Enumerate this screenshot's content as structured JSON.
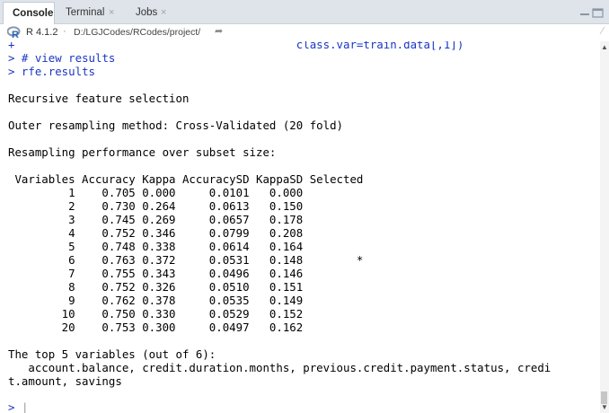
{
  "tabs": [
    {
      "label": "Console",
      "active": true
    },
    {
      "label": "Terminal",
      "close": "×"
    },
    {
      "label": "Jobs",
      "close": "×"
    }
  ],
  "path_bar": {
    "r_version": "R 4.1.2",
    "separator": "·",
    "working_dir": "D:/LGJCodes/RCodes/project/",
    "arrow_icon": "share-arrow-icon"
  },
  "console": {
    "top_cut_line": {
      "prompt": "+",
      "text": "                                          class.var=train.data[,1])"
    },
    "commands": [
      {
        "prompt": ">",
        "text": " # view results"
      },
      {
        "prompt": ">",
        "text": " rfe.results"
      }
    ],
    "title": "Recursive feature selection",
    "outer_method": "Outer resampling method: Cross-Validated (20 fold)",
    "perf_heading": "Resampling performance over subset size:",
    "table_header": " Variables Accuracy Kappa AccuracySD KappaSD Selected",
    "table_rows": [
      "         1    0.705 0.000     0.0101   0.000         ",
      "         2    0.730 0.264     0.0613   0.150         ",
      "         3    0.745 0.269     0.0657   0.178         ",
      "         4    0.752 0.346     0.0799   0.208         ",
      "         5    0.748 0.338     0.0614   0.164         ",
      "         6    0.763 0.372     0.0531   0.148        *",
      "         7    0.755 0.343     0.0496   0.146         ",
      "         8    0.752 0.326     0.0510   0.151         ",
      "         9    0.762 0.378     0.0535   0.149         ",
      "        10    0.750 0.330     0.0529   0.152         ",
      "        20    0.753 0.300     0.0497   0.162         "
    ],
    "top_vars_heading": "The top 5 variables (out of 6):",
    "top_vars_line1": "   account.balance, credit.duration.months, previous.credit.payment.status, credi",
    "top_vars_line2": "t.amount, savings",
    "input_prompt": ">",
    "input_cursor": "|"
  },
  "colors": {
    "prompt_blue": "#1b36c4",
    "output_black": "#000000",
    "tabbar_bg": "#dee4ea"
  }
}
